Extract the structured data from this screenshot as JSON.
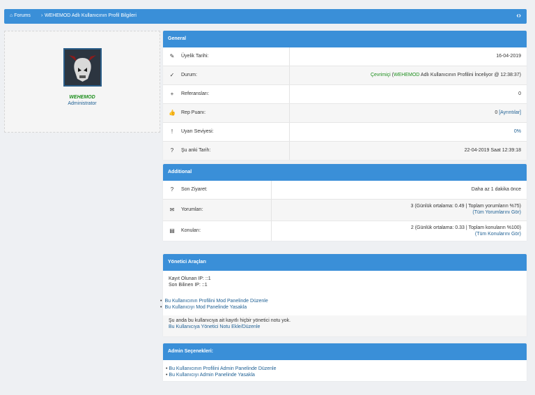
{
  "breadcrumb": {
    "home_label": "Forums",
    "separator": "›",
    "current": "WEHEMOD Adlı Kullanıcının Profil Bilgileri",
    "toggle_icon": "collapse-icon"
  },
  "profile": {
    "username": "WEHEMOD",
    "role": "Administrator",
    "avatar_icon": "skull-avatar"
  },
  "general": {
    "title": "General",
    "rows": [
      {
        "icon": "pencil-icon",
        "glyph": "✎",
        "label": "Üyelik Tarihi:",
        "value": "16-04-2019"
      },
      {
        "icon": "check-icon",
        "glyph": "✓",
        "label": "Durum:",
        "status": "Çevrimiçi",
        "status_detail_a": "(",
        "status_user": "WEHEMOD",
        "status_detail_b": " Adlı Kullanıcının Profilini İnceliyor @ 12:38:37)"
      },
      {
        "icon": "plus-icon",
        "glyph": "+",
        "label": "Referansları:",
        "value": "0"
      },
      {
        "icon": "thumb-icon",
        "glyph": "👍",
        "label": "Rep Puanı:",
        "value": "0",
        "value_link": "[Ayrıntılar]"
      },
      {
        "icon": "warning-icon",
        "glyph": "!",
        "label": "Uyarı Seviyesi:",
        "value_link": "0%"
      },
      {
        "icon": "question-icon",
        "glyph": "?",
        "label": "Şu anki Tarih:",
        "value": "22-04-2019 Saat 12:39:18"
      }
    ]
  },
  "additional": {
    "title": "Additional",
    "rows": [
      {
        "icon": "question-icon",
        "glyph": "?",
        "label": "Son Ziyaret:",
        "value": "Daha az 1 dakika önce"
      },
      {
        "icon": "comments-icon",
        "glyph": "✉",
        "label": "Yorumları:",
        "value": "3 (Günlük ortalama: 0.49 | Toplam yorumların %75)",
        "link": "(Tüm Yorumlarını Gör)"
      },
      {
        "icon": "document-icon",
        "glyph": "▤",
        "label": "Konuları:",
        "value": "2 (Günlük ortalama: 0.33 | Toplam konuların %100)",
        "link": "(Tüm Konularını Gör)"
      }
    ]
  },
  "mod_tools": {
    "title": "Yönetici Araçları",
    "registered_ip": "Kayıt Olunan IP: ::1",
    "last_ip": "Son Bilinen IP: ::1",
    "links": [
      "Bu Kullanıcının Profilini Mod Panelinde Düzenle",
      "Bu Kullanıcıyı Mod Panelinde Yasakla"
    ],
    "note": "Şu anda bu kullanıcıya ait kayıtlı hiçbir yönetici notu yok.",
    "note_link": "Bu Kullanıcıya Yönetici Notu Ekle/Düzenle"
  },
  "admin_options": {
    "title": "Admin Seçenekleri:",
    "links": [
      "Bu Kullanıcının Profilini Admin Panelinde Düzenle",
      "Bu Kullanıcıyı Admin Panelinde Yasakla"
    ]
  },
  "colors": {
    "header_blue": "#3a8fd8",
    "link_blue": "#1d5f93",
    "online_green": "#1e8f1e"
  }
}
